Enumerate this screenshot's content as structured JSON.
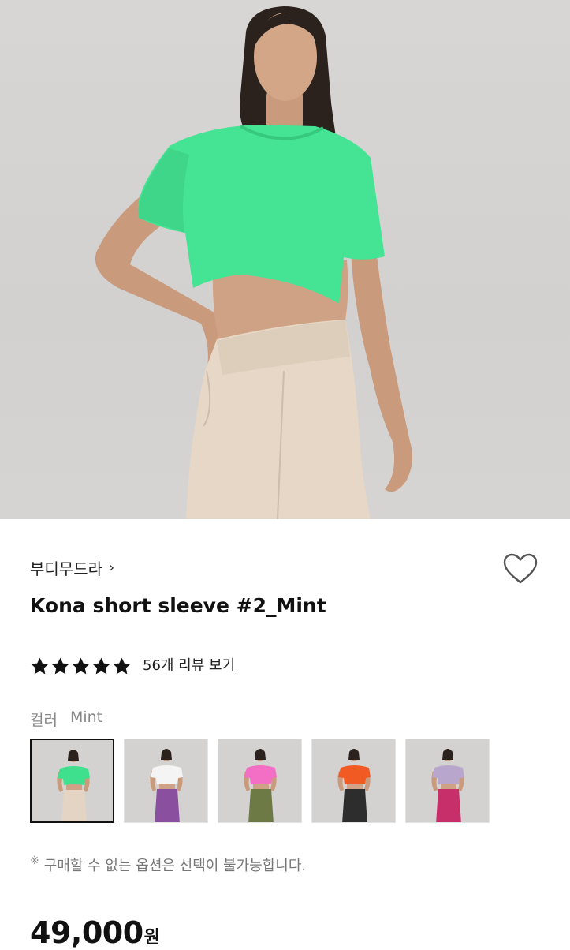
{
  "product": {
    "brand": "부디무드라",
    "brand_chevron": "›",
    "title": "Kona short sleeve #2_Mint",
    "rating": {
      "stars": 5,
      "review_link": "56개 리뷰 보기"
    },
    "color_option": {
      "label": "컬러",
      "selected": "Mint"
    },
    "swatches": [
      {
        "name": "Mint",
        "top_color": "#3ee08e",
        "bottom_color": "#e3d4c3",
        "selected": true
      },
      {
        "name": "White",
        "top_color": "#f4f4f4",
        "bottom_color": "#8a4f9e",
        "selected": false
      },
      {
        "name": "Pink",
        "top_color": "#f26fc5",
        "bottom_color": "#6e7a45",
        "selected": false
      },
      {
        "name": "Orange",
        "top_color": "#f25a24",
        "bottom_color": "#2d2d2d",
        "selected": false
      },
      {
        "name": "Lavender",
        "top_color": "#b9a6cc",
        "bottom_color": "#c72f6a",
        "selected": false
      }
    ],
    "notice_mark": "※",
    "notice": "구매할 수 없는 옵션은 선택이 불가능합니다.",
    "price": "49,000",
    "price_unit": "원"
  },
  "colors": {
    "hero_shirt": "#45e394",
    "hero_pants": "#e6d7c6",
    "text_primary": "#111111",
    "text_muted": "#888888"
  }
}
